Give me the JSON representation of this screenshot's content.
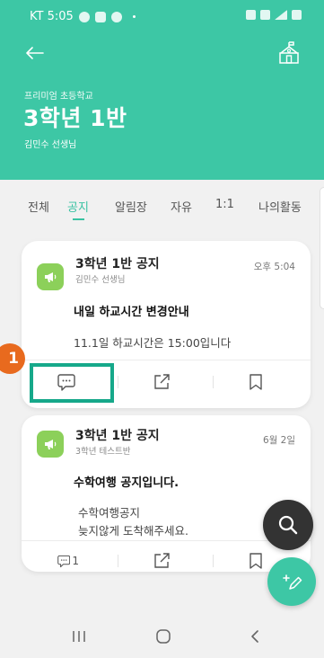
{
  "status_bar": {
    "carrier_time": "KT 5:05"
  },
  "header": {
    "school_name": "프리미엄 초등학교",
    "class_title": "3학년 1반",
    "teacher": "김민수 선생님",
    "bg_color": "#3dc7a5"
  },
  "tabs": [
    {
      "label": "전체",
      "active": false
    },
    {
      "label": "공지",
      "active": true
    },
    {
      "label": "알림장",
      "active": false
    },
    {
      "label": "자유",
      "active": false
    },
    {
      "label": "1:1",
      "active": false
    },
    {
      "label": "나의활동",
      "active": false
    }
  ],
  "posts": [
    {
      "board_title": "3학년 1반 공지",
      "author": "김민수 선생님",
      "time": "오후 5:04",
      "title": "내일 하교시간 변경안내",
      "body": [
        "11.1일 하교시간은 15:00입니다"
      ],
      "comment_count": ""
    },
    {
      "board_title": "3학년 1반 공지",
      "author": "3학년 테스트반",
      "time": "6월 2일",
      "title": "수학여행 공지입니다.",
      "body": [
        "수학여행공지",
        "늦지않게 도착해주세요."
      ],
      "comment_count": "1"
    }
  ],
  "annotation": {
    "step": "1",
    "color": "#e86a1e",
    "box_color": "#16a88a"
  },
  "accent_color": "#39c2a2",
  "icons": {
    "back": "arrow-left-icon",
    "home": "school-icon",
    "post_badge": "megaphone-icon",
    "comment": "comment-icon",
    "share": "share-icon",
    "bookmark": "bookmark-icon",
    "search": "search-icon",
    "write": "write-icon"
  }
}
